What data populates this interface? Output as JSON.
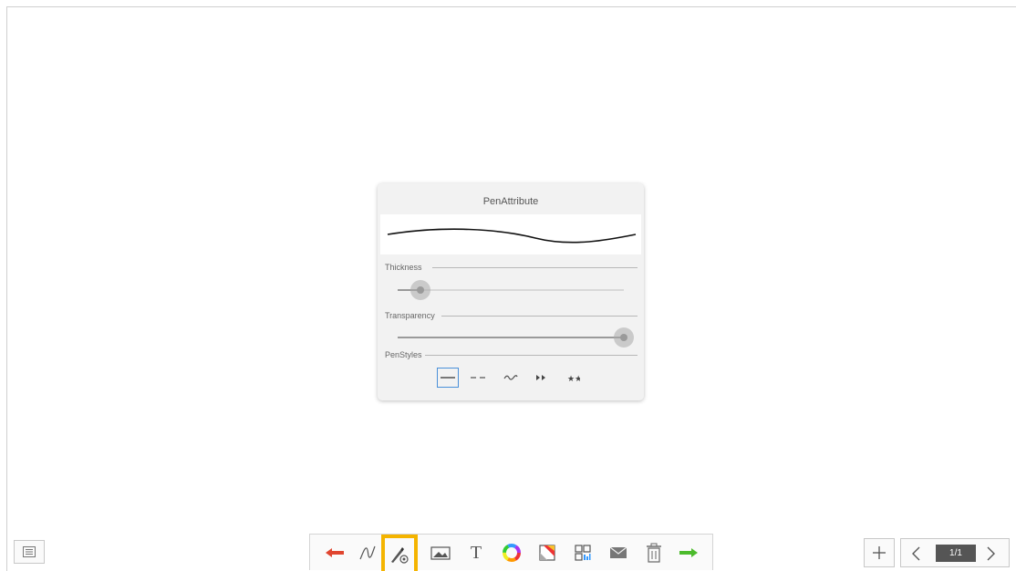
{
  "dialog": {
    "title": "PenAttribute",
    "thickness_label": "Thickness",
    "transparency_label": "Transparency",
    "penstyles_label": "PenStyles",
    "thickness_value": 0.1,
    "transparency_value": 1.0,
    "pen_styles": [
      {
        "icon": "solid-line-icon",
        "selected": true
      },
      {
        "icon": "dashed-line-icon",
        "selected": false
      },
      {
        "icon": "wave-line-icon",
        "selected": false
      },
      {
        "icon": "arrow-line-icon",
        "selected": false
      },
      {
        "icon": "star-line-icon",
        "selected": false
      }
    ]
  },
  "toolbar": {
    "tools": [
      "undo-arrow-icon",
      "pen-icon",
      "pen-settings-icon",
      "image-icon",
      "text-icon",
      "color-wheel-icon",
      "background-icon",
      "qr-code-icon",
      "mail-icon",
      "trash-icon",
      "redo-arrow-icon"
    ],
    "active_tool": "pen-settings-icon",
    "text_tool_glyph": "T"
  },
  "pager": {
    "page_indicator": "1/1"
  },
  "colors": {
    "undo": "#e0452f",
    "redo": "#4cbb2c",
    "active_highlight": "#f4b400",
    "selected_style": "#4a90d9"
  }
}
